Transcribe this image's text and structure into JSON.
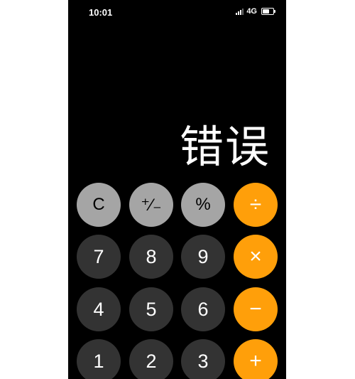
{
  "status_bar": {
    "time": "10:01",
    "network": "4G"
  },
  "display": {
    "value": "错误"
  },
  "keys": {
    "clear": "C",
    "sign": "⁺∕₋",
    "percent": "%",
    "divide": "÷",
    "seven": "7",
    "eight": "8",
    "nine": "9",
    "multiply": "×",
    "four": "4",
    "five": "5",
    "six": "6",
    "minus": "−",
    "one": "1",
    "two": "2",
    "three": "3",
    "plus": "+"
  },
  "colors": {
    "background": "#000000",
    "function_key": "#a5a5a5",
    "number_key": "#333333",
    "operator_key": "#ff9f0a"
  }
}
